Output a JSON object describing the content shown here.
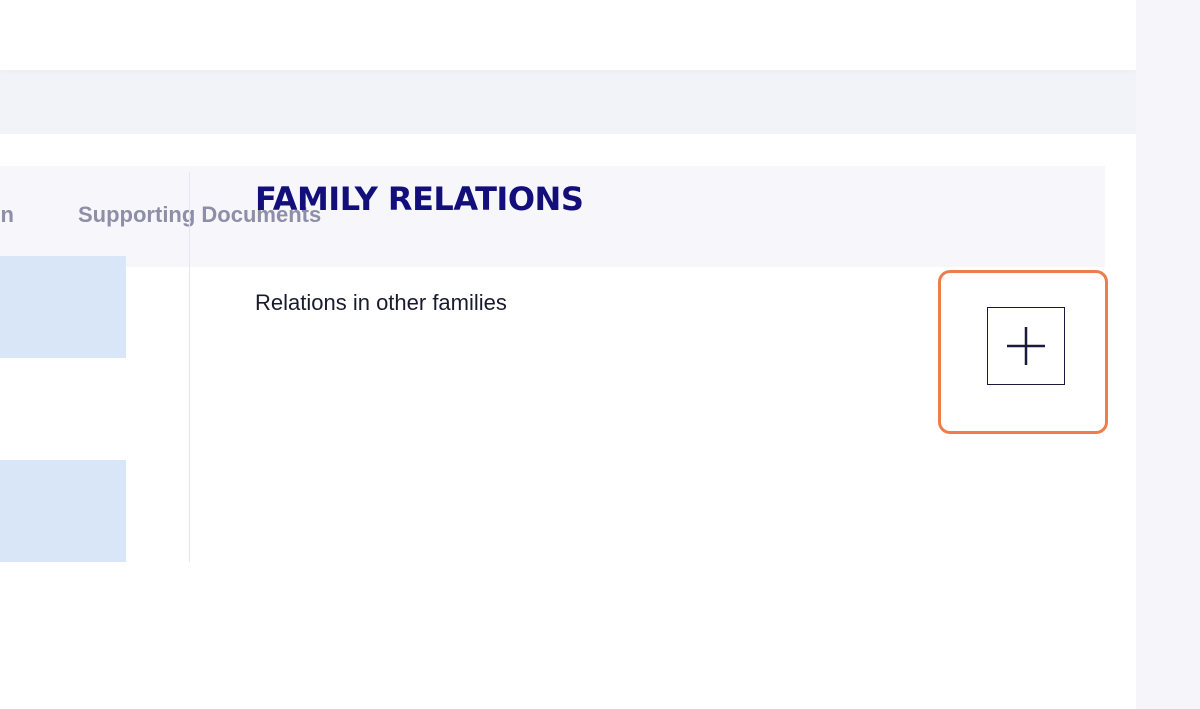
{
  "tabs": {
    "previous_partial_label": "n",
    "supporting_documents_label": "Supporting Documents"
  },
  "section": {
    "title": "FAMILY RELATIONS",
    "subtitle": "Relations in other families"
  },
  "add_button": {
    "icon": "plus-icon"
  },
  "colors": {
    "background": "#f2f3f8",
    "tab_bar": "#f6f6fb",
    "tab_text": "#8e8ea8",
    "title": "#120f7a",
    "highlight": "#f07c4c",
    "placeholder_block": "#d8e6f7"
  }
}
